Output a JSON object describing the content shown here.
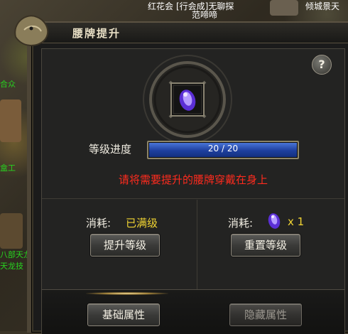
{
  "scene": {
    "top_texts": [
      "红花会",
      "[行会成]无聊探",
      "范啼啼",
      "倾城景天"
    ],
    "left_texts": [
      "合众",
      "盒工",
      "部天",
      "八部天龙",
      "天龙技"
    ]
  },
  "panel": {
    "title": "腰牌提升",
    "help_label": "?",
    "progress_label": "等级进度",
    "progress_text": "20 / 20",
    "progress_value": 1.0,
    "warning": "请将需要提升的腰牌穿戴在身上",
    "left_cost_label": "消耗:",
    "left_cost_value": "已满级",
    "upgrade_button": "提升等级",
    "right_cost_label": "消耗:",
    "right_cost_qty": "x 1",
    "reset_button": "重置等级",
    "basic_tab": "基础属性",
    "hidden_tab": "隐藏属性"
  },
  "colors": {
    "warning": "#ff2b1e",
    "highlight": "#f1d433",
    "progress": "#2a52c0"
  }
}
